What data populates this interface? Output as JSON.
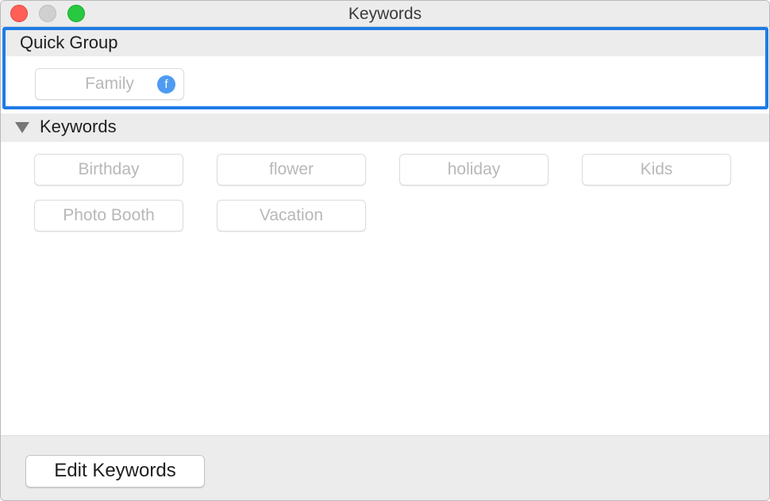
{
  "window": {
    "title": "Keywords"
  },
  "quick_group": {
    "title": "Quick Group",
    "items": [
      {
        "label": "Family",
        "shortcut": "f"
      }
    ]
  },
  "keywords": {
    "title": "Keywords",
    "expanded": true,
    "items": [
      "Birthday",
      "flower",
      "holiday",
      "Kids",
      "Photo Booth",
      "Vacation"
    ]
  },
  "footer": {
    "edit_label": "Edit Keywords"
  },
  "colors": {
    "focus_ring": "#1f7ce6",
    "shortcut_badge": "#4f9bf2"
  }
}
